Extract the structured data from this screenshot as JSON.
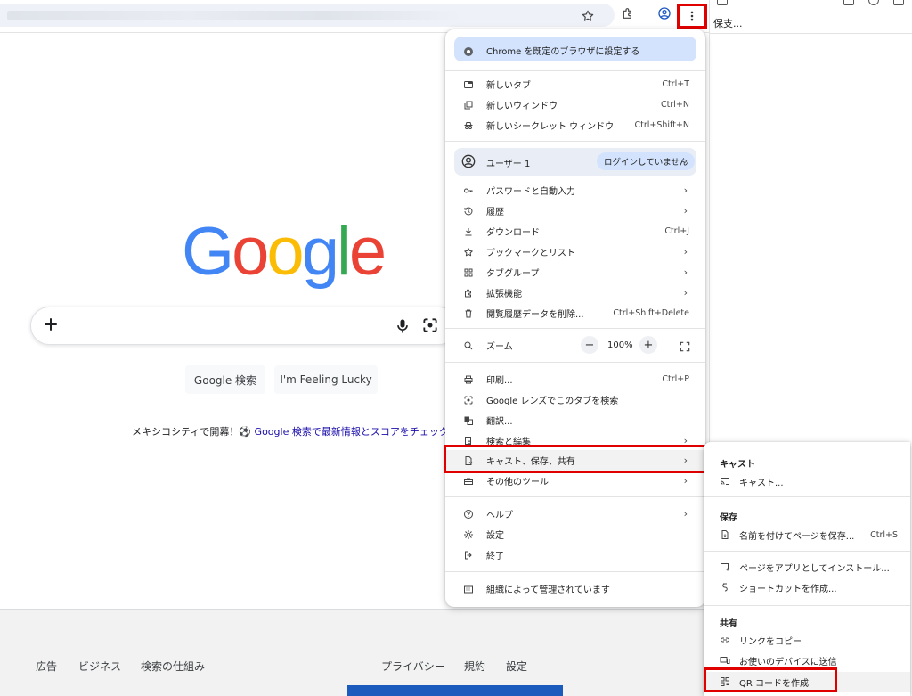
{
  "toolbar": {
    "bookmark_icon": "star-icon",
    "extensions_icon": "puzzle-icon",
    "profile_icon": "account-icon",
    "menu_icon": "three-dots-vertical-icon"
  },
  "right_window": {
    "label": "保支..."
  },
  "google": {
    "logo": [
      "G",
      "o",
      "o",
      "g",
      "l",
      "e"
    ],
    "logo_colors": [
      "#4285F4",
      "#EA4335",
      "#FBBC05",
      "#4285F4",
      "#34A853",
      "#EA4335"
    ],
    "search_button": "Google 検索",
    "lucky_button": "I'm Feeling Lucky",
    "promo_text": "メキシコシティで開幕！⚽",
    "promo_link": "Google 検索で最新情報とスコアをチェック",
    "footer": {
      "ads": "広告",
      "business": "ビジネス",
      "how_search_works": "検索の仕組み",
      "privacy": "プライバシー",
      "terms": "規約",
      "settings": "設定"
    }
  },
  "menu": {
    "set_default": "Chrome を既定のブラウザに設定する",
    "new_tab": "新しいタブ",
    "new_tab_shortcut": "Ctrl+T",
    "new_window": "新しいウィンドウ",
    "new_window_shortcut": "Ctrl+N",
    "incognito": "新しいシークレット ウィンドウ",
    "incognito_shortcut": "Ctrl+Shift+N",
    "user": "ユーザー 1",
    "login_status": "ログインしていません",
    "passwords": "パスワードと自動入力",
    "history": "履歴",
    "downloads": "ダウンロード",
    "downloads_shortcut": "Ctrl+J",
    "bookmarks": "ブックマークとリスト",
    "tab_groups": "タブグループ",
    "extensions": "拡張機能",
    "clear_data": "閲覧履歴データを削除...",
    "clear_data_shortcut": "Ctrl+Shift+Delete",
    "zoom": "ズーム",
    "zoom_minus": "−",
    "zoom_value": "100%",
    "zoom_plus": "+",
    "print": "印刷...",
    "print_shortcut": "Ctrl+P",
    "lens": "Google レンズでこのタブを検索",
    "translate": "翻訳...",
    "find_edit": "検索と編集",
    "cast_save_share": "キャスト、保存、共有",
    "more_tools": "その他のツール",
    "help": "ヘルプ",
    "settings": "設定",
    "exit": "終了",
    "managed": "組織によって管理されています"
  },
  "submenu": {
    "cast_header": "キャスト",
    "cast": "キャスト...",
    "save_header": "保存",
    "save_page": "名前を付けてページを保存...",
    "save_page_shortcut": "Ctrl+S",
    "install_app": "ページをアプリとしてインストール...",
    "create_shortcut": "ショートカットを作成...",
    "share_header": "共有",
    "copy_link": "リンクをコピー",
    "send_to_devices": "お使いのデバイスに送信",
    "qr_code": "QR コードを作成"
  },
  "colors": {
    "highlight": "#e00000",
    "pill_blue": "#d3e3fd",
    "link": "#1a0dab"
  }
}
